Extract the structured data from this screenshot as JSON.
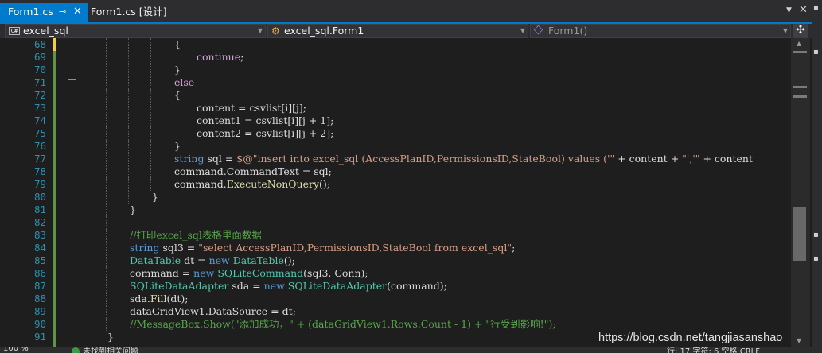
{
  "tabs": [
    {
      "label": "Form1.cs",
      "active": true
    },
    {
      "label": "Form1.cs [设计]",
      "active": false
    }
  ],
  "nav": {
    "project": "excel_sql",
    "class": "excel_sql.Form1",
    "member": "Form1()"
  },
  "code_lines": [
    {
      "num": "68",
      "indent": 4,
      "tokens": [
        {
          "t": "{",
          "c": "pl"
        }
      ]
    },
    {
      "num": "69",
      "indent": 5,
      "tokens": [
        {
          "t": "continue",
          "c": "ctl"
        },
        {
          "t": ";",
          "c": "pl"
        }
      ]
    },
    {
      "num": "70",
      "indent": 4,
      "tokens": [
        {
          "t": "}",
          "c": "pl"
        }
      ]
    },
    {
      "num": "71",
      "indent": 4,
      "tokens": [
        {
          "t": "else",
          "c": "ctl"
        }
      ]
    },
    {
      "num": "72",
      "indent": 4,
      "tokens": [
        {
          "t": "{",
          "c": "pl"
        }
      ]
    },
    {
      "num": "73",
      "indent": 5,
      "tokens": [
        {
          "t": "content = csvlist[i][j];",
          "c": "pl"
        }
      ]
    },
    {
      "num": "74",
      "indent": 5,
      "tokens": [
        {
          "t": "content1 = csvlist[i][j + 1];",
          "c": "pl"
        }
      ]
    },
    {
      "num": "75",
      "indent": 5,
      "tokens": [
        {
          "t": "content2 = csvlist[i][j + 2];",
          "c": "pl"
        }
      ]
    },
    {
      "num": "76",
      "indent": 4,
      "tokens": [
        {
          "t": "}",
          "c": "pl"
        }
      ]
    },
    {
      "num": "77",
      "indent": 4,
      "tokens": [
        {
          "t": "string",
          "c": "kw"
        },
        {
          "t": " sql = ",
          "c": "pl"
        },
        {
          "t": "$@\"insert into excel_sql (AccessPlanID,PermissionsID,StateBool) values ('\"",
          "c": "str"
        },
        {
          "t": " + content + ",
          "c": "pl"
        },
        {
          "t": "\"','\"",
          "c": "str"
        },
        {
          "t": " + content",
          "c": "pl"
        }
      ]
    },
    {
      "num": "78",
      "indent": 4,
      "tokens": [
        {
          "t": "command.CommandText = sql;",
          "c": "pl"
        }
      ]
    },
    {
      "num": "79",
      "indent": 4,
      "tokens": [
        {
          "t": "command.",
          "c": "pl"
        },
        {
          "t": "ExecuteNonQuery",
          "c": "fn"
        },
        {
          "t": "();",
          "c": "pl"
        }
      ]
    },
    {
      "num": "80",
      "indent": 3,
      "tokens": [
        {
          "t": "}",
          "c": "pl"
        }
      ]
    },
    {
      "num": "81",
      "indent": 2,
      "tokens": [
        {
          "t": "}",
          "c": "pl"
        }
      ]
    },
    {
      "num": "82",
      "indent": 2,
      "tokens": []
    },
    {
      "num": "83",
      "indent": 2,
      "tokens": [
        {
          "t": "//打印excel_sql表格里面数据",
          "c": "cmt"
        }
      ]
    },
    {
      "num": "84",
      "indent": 2,
      "tokens": [
        {
          "t": "string",
          "c": "kw"
        },
        {
          "t": " sql3 = ",
          "c": "pl"
        },
        {
          "t": "\"select AccessPlanID,PermissionsID,StateBool from excel_sql\"",
          "c": "str"
        },
        {
          "t": ";",
          "c": "pl"
        }
      ]
    },
    {
      "num": "85",
      "indent": 2,
      "tokens": [
        {
          "t": "DataTable",
          "c": "ty"
        },
        {
          "t": " dt = ",
          "c": "pl"
        },
        {
          "t": "new",
          "c": "kw"
        },
        {
          "t": " ",
          "c": "pl"
        },
        {
          "t": "DataTable",
          "c": "ty"
        },
        {
          "t": "();",
          "c": "pl"
        }
      ]
    },
    {
      "num": "86",
      "indent": 2,
      "tokens": [
        {
          "t": "command = ",
          "c": "pl"
        },
        {
          "t": "new",
          "c": "kw"
        },
        {
          "t": " ",
          "c": "pl"
        },
        {
          "t": "SQLiteCommand",
          "c": "ty"
        },
        {
          "t": "(sql3, Conn);",
          "c": "pl"
        }
      ]
    },
    {
      "num": "87",
      "indent": 2,
      "tokens": [
        {
          "t": "SQLiteDataAdapter",
          "c": "ty"
        },
        {
          "t": " sda = ",
          "c": "pl"
        },
        {
          "t": "new",
          "c": "kw"
        },
        {
          "t": " ",
          "c": "pl"
        },
        {
          "t": "SQLiteDataAdapter",
          "c": "ty"
        },
        {
          "t": "(command);",
          "c": "pl"
        }
      ]
    },
    {
      "num": "88",
      "indent": 2,
      "tokens": [
        {
          "t": "sda.",
          "c": "pl"
        },
        {
          "t": "Fill",
          "c": "fn"
        },
        {
          "t": "(dt);",
          "c": "pl"
        }
      ]
    },
    {
      "num": "89",
      "indent": 2,
      "tokens": [
        {
          "t": "dataGridView1.DataSource = dt;",
          "c": "pl"
        }
      ]
    },
    {
      "num": "90",
      "indent": 2,
      "tokens": [
        {
          "t": "//MessageBox.Show(\"添加成功，\" + (dataGridView1.Rows.Count - 1) + \"行受到影响!\");",
          "c": "cmt"
        }
      ]
    },
    {
      "num": "91",
      "indent": 1,
      "tokens": [
        {
          "t": "}",
          "c": "pl"
        }
      ]
    }
  ],
  "status": {
    "zoom": "100 %",
    "issues": "未找到相关问题",
    "position": "行: 17    字符: 6    空格    CRLF"
  },
  "watermark": "https://blog.csdn.net/tangjiasanshao",
  "colors": {
    "accent": "#007acc",
    "keyword": "#569cd6",
    "control": "#d8a0df",
    "type": "#4ec9b0",
    "string": "#d69d85",
    "comment": "#57a64a",
    "method": "#dcdcaa",
    "line_number": "#2b91af"
  }
}
